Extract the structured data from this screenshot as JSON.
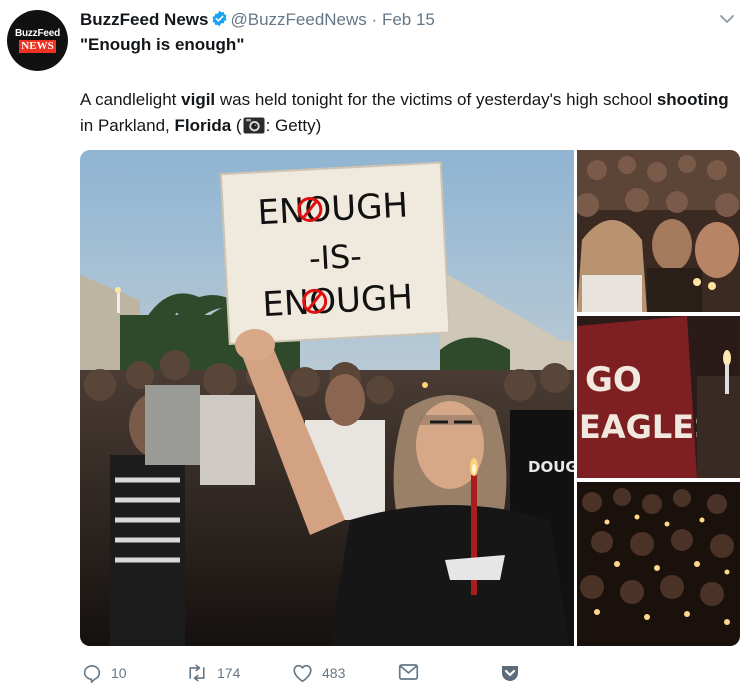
{
  "account": {
    "avatar_top": "BuzzFeed",
    "avatar_bottom": "NEWS",
    "name": "BuzzFeed News",
    "handle": "@BuzzFeedNews",
    "separator": "·",
    "date": "Feb 15"
  },
  "tweet": {
    "quote": "\"Enough is enough\"",
    "text_parts": [
      "A candlelight ",
      "vigil",
      " was held tonight for the victims of yesterday's high school ",
      "shooting",
      " in Parkland, ",
      "Florida",
      " (",
      ": Getty)"
    ]
  },
  "media": {
    "sign_line1": "ENOUGH",
    "sign_line2": "-IS-",
    "sign_line3": "ENOUGH",
    "shirt_text_1": "GO",
    "shirt_text_2": "EAGLES",
    "shirt_text_3": "DOUG"
  },
  "actions": {
    "reply_count": "10",
    "retweet_count": "174",
    "like_count": "483"
  },
  "colors": {
    "verified": "#1da1f2",
    "muted": "#657786",
    "text": "#14171a",
    "brand_red": "#ee3322"
  }
}
